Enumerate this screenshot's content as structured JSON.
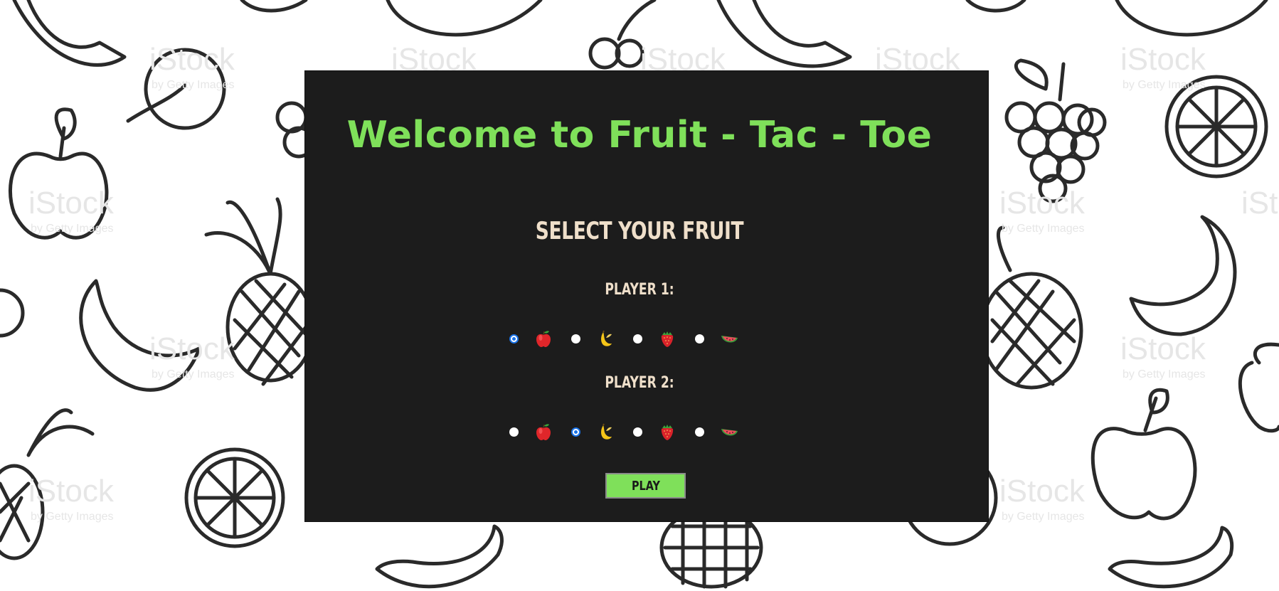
{
  "page": {
    "title": "Welcome to Fruit - Tac - Toe",
    "subtitle": "SELECT YOUR FRUIT",
    "play_label": "PLAY"
  },
  "players": [
    {
      "label": "PLAYER 1:",
      "selected": "apple"
    },
    {
      "label": "PLAYER 2:",
      "selected": "banana"
    }
  ],
  "fruits": [
    "apple",
    "banana",
    "strawberry",
    "watermelon"
  ],
  "background": {
    "watermark_main": "iStock",
    "watermark_sub": "by Getty Images"
  },
  "colors": {
    "title": "#7fe05a",
    "label": "#efdfca",
    "panel": "#1c1c1c",
    "button": "#7fe05a",
    "radio_selected": "#1a73e8"
  }
}
